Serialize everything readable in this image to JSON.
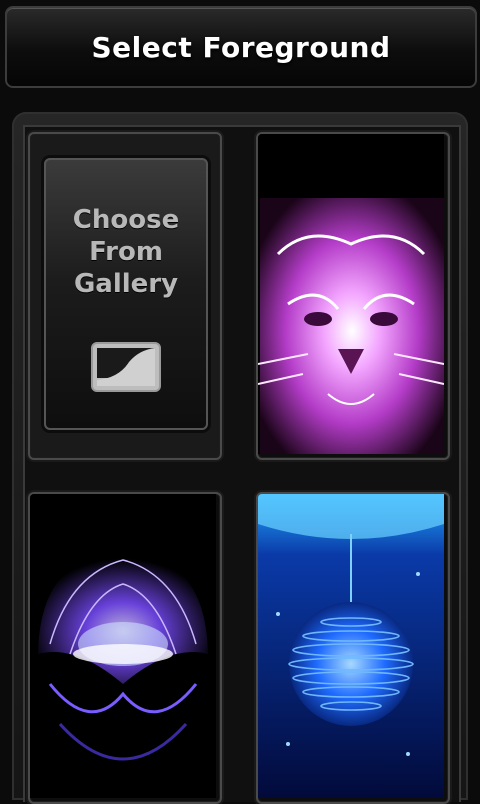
{
  "header": {
    "title": "Select Foreground"
  },
  "gallery": {
    "label_lines": [
      "Choose",
      "From",
      "Gallery"
    ]
  },
  "colors": {
    "tiger_accent": "#e070e8",
    "jellyfish_accent": "#8a66ff",
    "ornament_accent": "#2a8cff"
  },
  "tiles": [
    {
      "icon": "neon-tiger-image"
    },
    {
      "icon": "neon-jellyfish-image"
    },
    {
      "icon": "neon-ornament-image"
    }
  ]
}
